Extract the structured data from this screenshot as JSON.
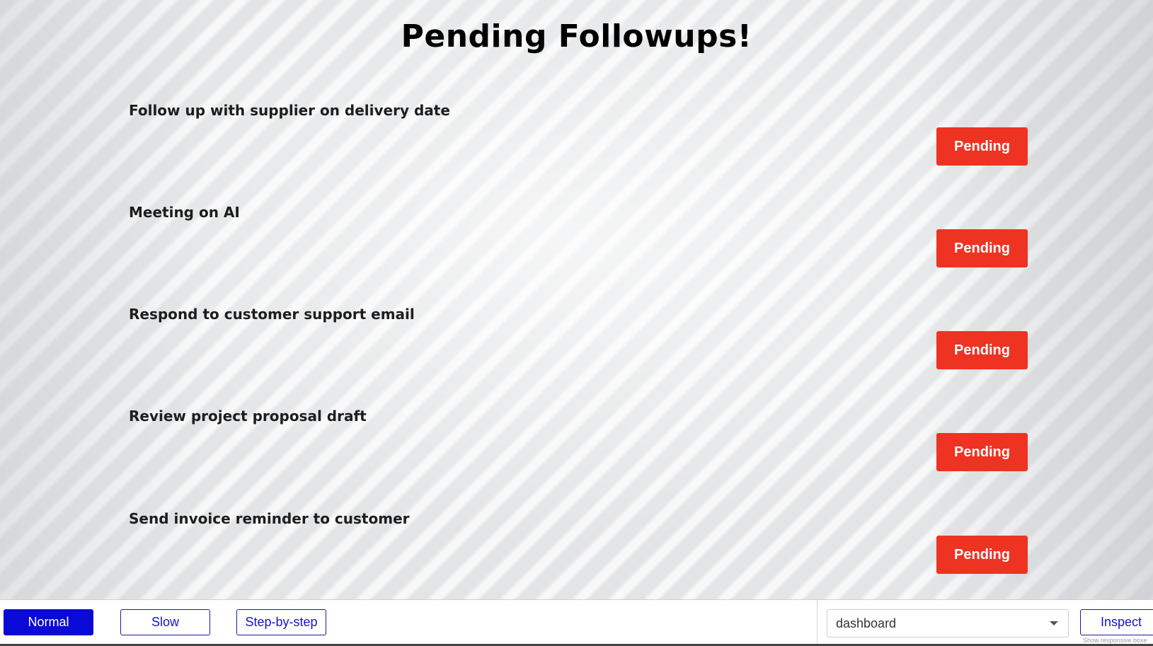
{
  "page": {
    "title": "Pending Followups!"
  },
  "tasks": [
    {
      "label": "Follow up with supplier on delivery date",
      "status": "Pending"
    },
    {
      "label": "Meeting on AI",
      "status": "Pending"
    },
    {
      "label": "Respond to customer support email",
      "status": "Pending"
    },
    {
      "label": "Review project proposal draft",
      "status": "Pending"
    },
    {
      "label": "Send invoice reminder to customer",
      "status": "Pending"
    }
  ],
  "toolbar": {
    "modes": [
      {
        "label": "Normal",
        "active": true
      },
      {
        "label": "Slow",
        "active": false
      },
      {
        "label": "Step-by-step",
        "active": false
      }
    ],
    "view_select": {
      "value": "dashboard",
      "icon": "chevron-down-icon"
    },
    "inspect_label": "Inspect",
    "hint": "Show responsive boxe"
  },
  "colors": {
    "status_button": "#ee3322",
    "mode_active": "#0a0ad6",
    "mode_text": "#1414c8"
  }
}
